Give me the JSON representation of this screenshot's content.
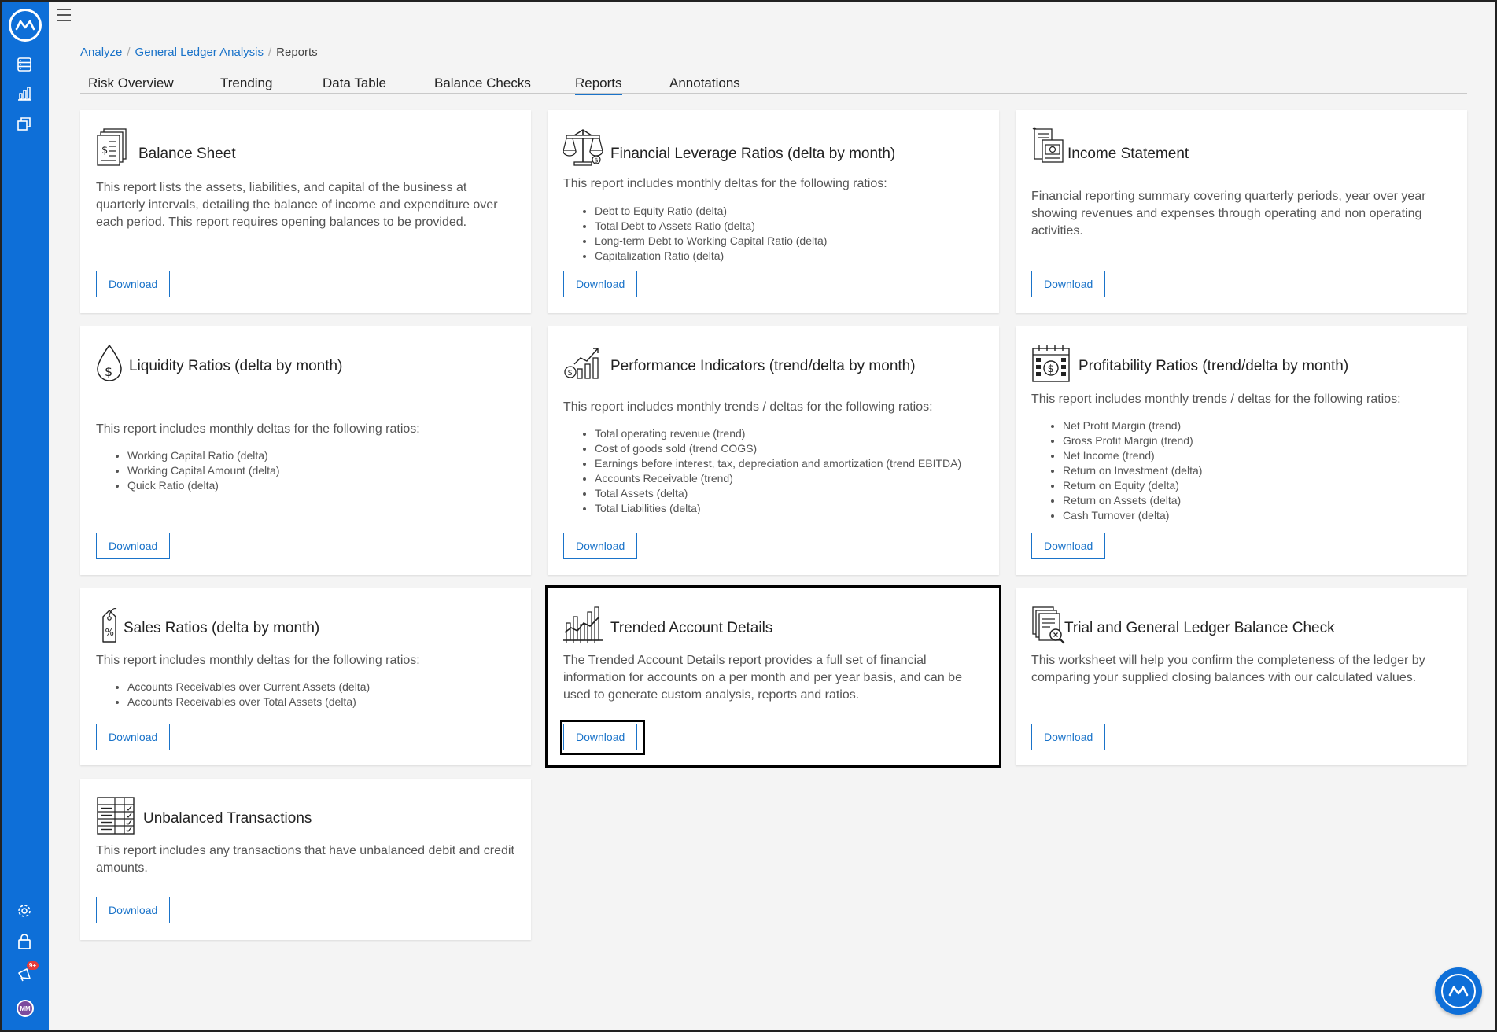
{
  "colors": {
    "sidebar": "#0e6fd8",
    "link": "#1a73c9",
    "badge": "#e43b3b"
  },
  "sidebar": {
    "items": [
      {
        "icon": "data-list-icon"
      },
      {
        "icon": "bar-chart-icon"
      },
      {
        "icon": "report-stack-icon"
      }
    ],
    "bottom": [
      {
        "icon": "gear-icon"
      },
      {
        "icon": "lock-icon"
      },
      {
        "icon": "announcement-icon",
        "badge": "9+"
      }
    ],
    "avatar": "MM"
  },
  "breadcrumb": {
    "items": [
      "Analyze",
      "General Ledger Analysis"
    ],
    "current": "Reports",
    "separator": "/"
  },
  "tabs": [
    "Risk Overview",
    "Trending",
    "Data Table",
    "Balance Checks",
    "Reports",
    "Annotations"
  ],
  "active_tab": "Reports",
  "cards": [
    {
      "icon": "balance-sheet-icon",
      "title": "Balance Sheet",
      "description": "This report lists the assets, liabilities, and capital of the business at quarterly intervals, detailing the balance of income and expenditure over each period. This report requires opening balances to be provided.",
      "items": [],
      "button": "Download"
    },
    {
      "icon": "scales-icon",
      "title": "Financial Leverage Ratios (delta by month)",
      "description": "This report includes monthly deltas for the following ratios:",
      "items": [
        "Debt to Equity Ratio (delta)",
        "Total Debt to Assets Ratio (delta)",
        "Long-term Debt to Working Capital Ratio (delta)",
        "Capitalization Ratio (delta)"
      ],
      "button": "Download"
    },
    {
      "icon": "income-statement-icon",
      "title": "Income Statement",
      "description": "Financial reporting summary covering quarterly periods, year over year showing revenues and expenses through operating and non operating activities.",
      "items": [],
      "button": "Download"
    },
    {
      "icon": "dollar-drop-icon",
      "title": "Liquidity Ratios (delta by month)",
      "description": "This report includes monthly deltas for the following ratios:",
      "items": [
        "Working Capital Ratio (delta)",
        "Working Capital Amount (delta)",
        "Quick Ratio (delta)"
      ],
      "button": "Download"
    },
    {
      "icon": "growth-chart-icon",
      "title": "Performance Indicators (trend/delta by month)",
      "description": "This report includes monthly trends / deltas for the following ratios:",
      "items": [
        "Total operating revenue (trend)",
        "Cost of goods sold (trend COGS)",
        "Earnings before interest, tax, depreciation and amortization (trend EBITDA)",
        "Accounts Receivable (trend)",
        "Total Assets (delta)",
        "Total Liabilities (delta)"
      ],
      "button": "Download"
    },
    {
      "icon": "calendar-dollar-icon",
      "title": "Profitability Ratios (trend/delta by month)",
      "description": "This report includes monthly trends / deltas for the following ratios:",
      "items": [
        "Net Profit Margin (trend)",
        "Gross Profit Margin (trend)",
        "Net Income (trend)",
        "Return on Investment (delta)",
        "Return on Equity (delta)",
        "Return on Assets (delta)",
        "Cash Turnover (delta)"
      ],
      "button": "Download"
    },
    {
      "icon": "price-tag-icon",
      "title": "Sales Ratios (delta by month)",
      "description": "This report includes monthly deltas for the following ratios:",
      "items": [
        "Accounts Receivables over Current Assets (delta)",
        "Accounts Receivables over Total Assets (delta)"
      ],
      "button": "Download"
    },
    {
      "icon": "trend-bars-icon",
      "title": "Trended Account Details",
      "description": "The Trended Account Details report provides a full set of financial information for accounts on a per month and per year basis, and can be used to generate custom analysis, reports and ratios.",
      "items": [],
      "button": "Download"
    },
    {
      "icon": "document-search-icon",
      "title": "Trial and General Ledger Balance Check",
      "description": "This worksheet will help you confirm the completeness of the ledger by comparing your supplied closing balances with our calculated values.",
      "items": [],
      "button": "Download"
    },
    {
      "icon": "checklist-table-icon",
      "title": "Unbalanced Transactions",
      "description": "This report includes any transactions that have unbalanced debit and credit amounts.",
      "items": [],
      "button": "Download"
    }
  ]
}
